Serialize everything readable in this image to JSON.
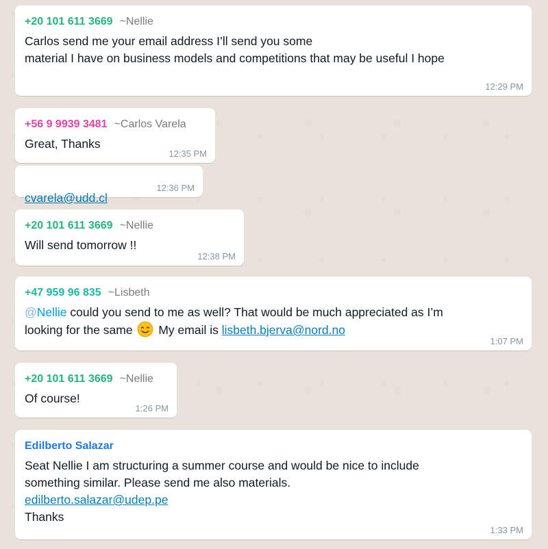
{
  "colors": {
    "green_sender": "#25b47e",
    "pink_sender": "#e542a3",
    "teal_sender": "#1fb8a2",
    "blue_sender": "#1f7ae0",
    "link": "#027eb5",
    "bubble": "#ffffff",
    "wallpaper": "#e9e2da"
  },
  "messages": [
    {
      "phone": "+20 101 611 3669",
      "alias": "~Nellie",
      "text": "Carlos send me your email address I’ll send you some\nmaterial I have on business models and competitions that may be useful I hope",
      "time": "12:29 PM"
    },
    {
      "phone": "+56 9 9939 3481",
      "alias": "~Carlos Varela",
      "text": "Great, Thanks",
      "time": "12:35 PM"
    },
    {
      "link": "cvarela@udd.cl",
      "time": "12:36 PM"
    },
    {
      "phone": "+20 101 611 3669",
      "alias": "~Nellie",
      "text": "Will send tomorrow !!",
      "time": "12:38 PM"
    },
    {
      "phone": "+47 959 96 835",
      "alias": "~Lisbeth",
      "mention_at": "@",
      "mention_name": "Nellie",
      "text_part1": " could you send to me as well? That would be much appreciated as I’m",
      "text_part2": "looking for the same",
      "emoji_name": "smiling-face-icon",
      "text_part3": "My email is",
      "link": "lisbeth.bjerva@nord.no",
      "time": "1:07 PM"
    },
    {
      "phone": "+20 101 611 3669",
      "alias": "~Nellie",
      "text": "Of course!",
      "time": "1:26 PM"
    },
    {
      "name": "Edilberto Salazar",
      "text": "Seat Nellie I am structuring a summer course and would be nice to include\nsomething similar. Please send me also materials.",
      "link": "edilberto.salazar@udep.pe",
      "text_after": "Thanks",
      "time": "1:33 PM"
    }
  ]
}
